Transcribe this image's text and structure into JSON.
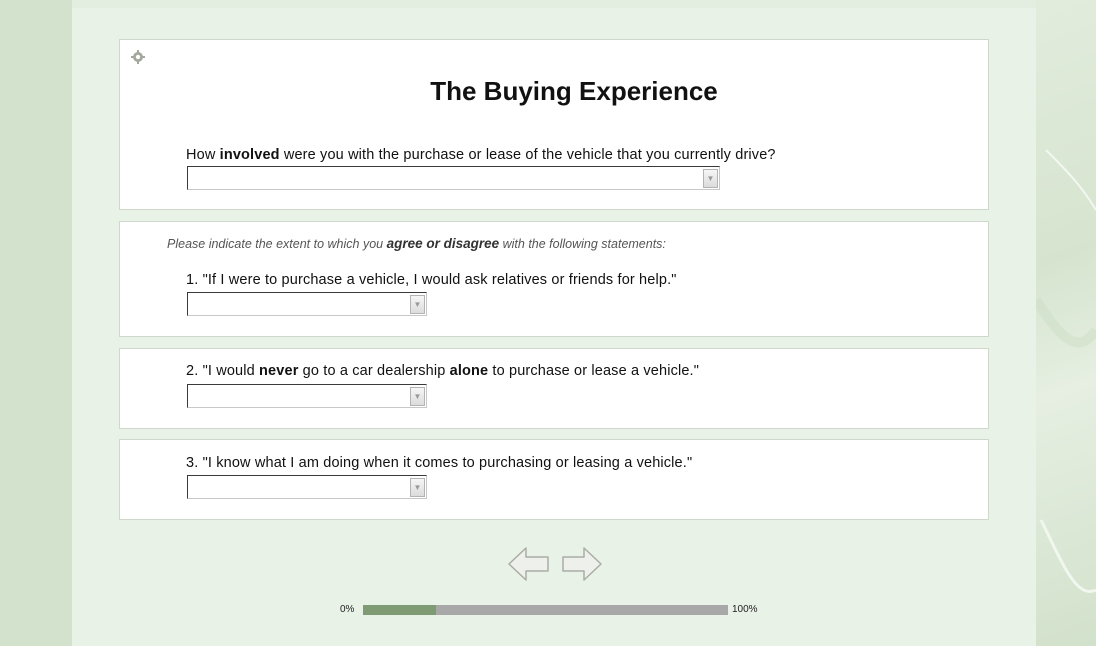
{
  "survey": {
    "title": "The Buying Experience",
    "q_involved": {
      "prefix": "How ",
      "bold": "involved",
      "suffix": " were you with the purchase or lease of the vehicle that you currently drive?",
      "value": ""
    },
    "instructions": {
      "prefix": "Please indicate the extent to which you ",
      "bold": "agree or disagree",
      "suffix": " with the following statements:"
    },
    "statements": [
      {
        "text": "1. \"If I were to purchase a vehicle, I would ask relatives or friends for help.\"",
        "value": ""
      },
      {
        "p1": "2. \"I would ",
        "b1": "never",
        "p2": " go to a car dealership ",
        "b2": "alone",
        "p3": " to purchase or lease a vehicle.\"",
        "value": ""
      },
      {
        "text": "3. \"I know what I am doing when it comes to purchasing or leasing a vehicle.\"",
        "value": ""
      }
    ]
  },
  "navigation": {
    "back_icon": "left-arrow-icon",
    "next_icon": "right-arrow-icon"
  },
  "progress": {
    "start_label": "0%",
    "end_label": "100%",
    "fraction": 0.2
  },
  "colors": {
    "progress_fill": "#7f9b73",
    "progress_track": "#a8a8a8",
    "background": "#dbe7d6"
  }
}
